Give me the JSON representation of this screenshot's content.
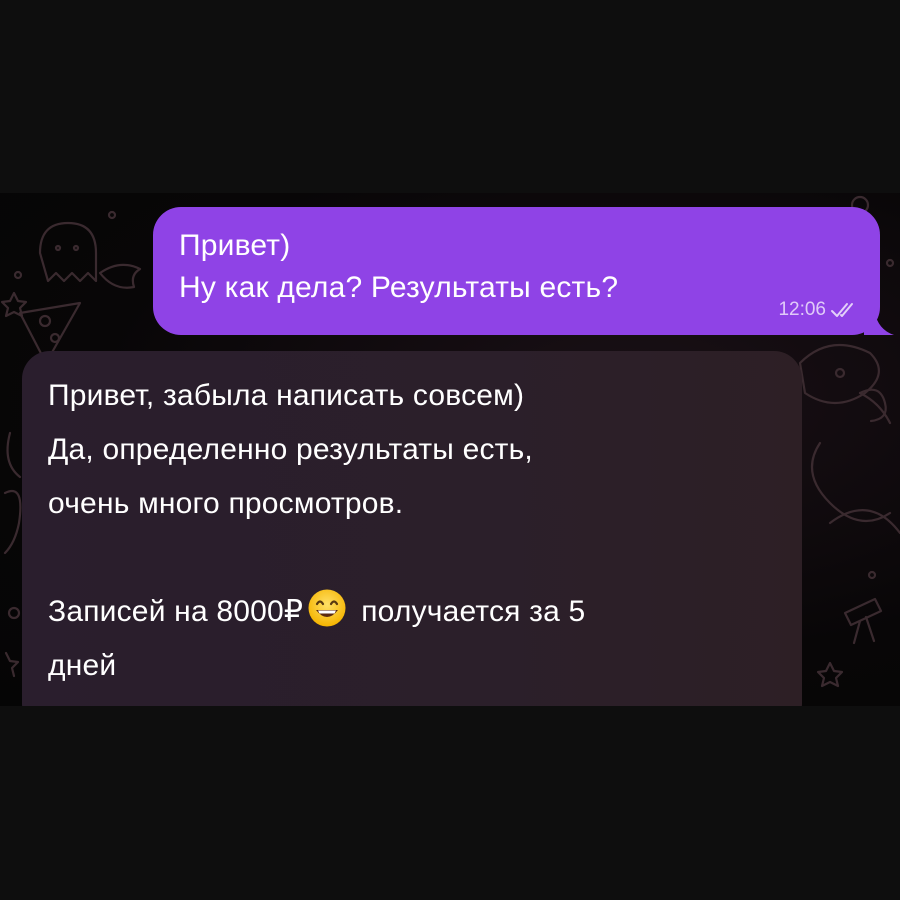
{
  "messages": {
    "outgoing": {
      "line1": "Привет)",
      "line2": "Ну как дела? Результаты есть?",
      "time": "12:06",
      "status_icon": "double-check-icon"
    },
    "incoming": {
      "line1": "Привет, забыла написать совсем)",
      "line2": "Да, определенно результаты есть,",
      "line3": "очень много просмотров.",
      "line4_before_emoji": "Записей на 8000₽",
      "emoji": "grinning-face-with-smiling-eyes",
      "line4_after_emoji": "получается за 5",
      "line5": "дней"
    }
  },
  "colors": {
    "outgoing_bubble": "#8f43e6",
    "incoming_bubble": "#2a1e2d",
    "background": "#080607"
  }
}
